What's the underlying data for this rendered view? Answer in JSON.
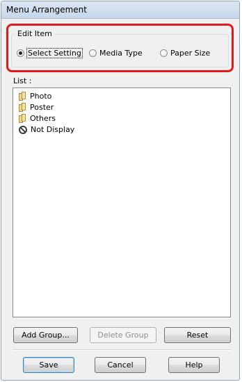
{
  "window": {
    "title": "Menu Arrangement"
  },
  "edit_item": {
    "legend": "Edit Item",
    "options": [
      {
        "label": "Select Setting",
        "checked": true
      },
      {
        "label": "Media Type",
        "checked": false
      },
      {
        "label": "Paper Size",
        "checked": false
      }
    ]
  },
  "list": {
    "label": "List :",
    "items": [
      {
        "label": "Photo",
        "icon": "folder-icon"
      },
      {
        "label": "Poster",
        "icon": "folder-icon"
      },
      {
        "label": "Others",
        "icon": "folder-icon"
      },
      {
        "label": "Not Display",
        "icon": "no-display-icon"
      }
    ]
  },
  "group_buttons": {
    "add_group": "Add Group...",
    "delete_group": "Delete Group",
    "reset": "Reset"
  },
  "dialog_buttons": {
    "save": "Save",
    "cancel": "Cancel",
    "help": "Help"
  },
  "colors": {
    "highlight": "#e3191b",
    "title_bar": "#c7d7ea"
  }
}
